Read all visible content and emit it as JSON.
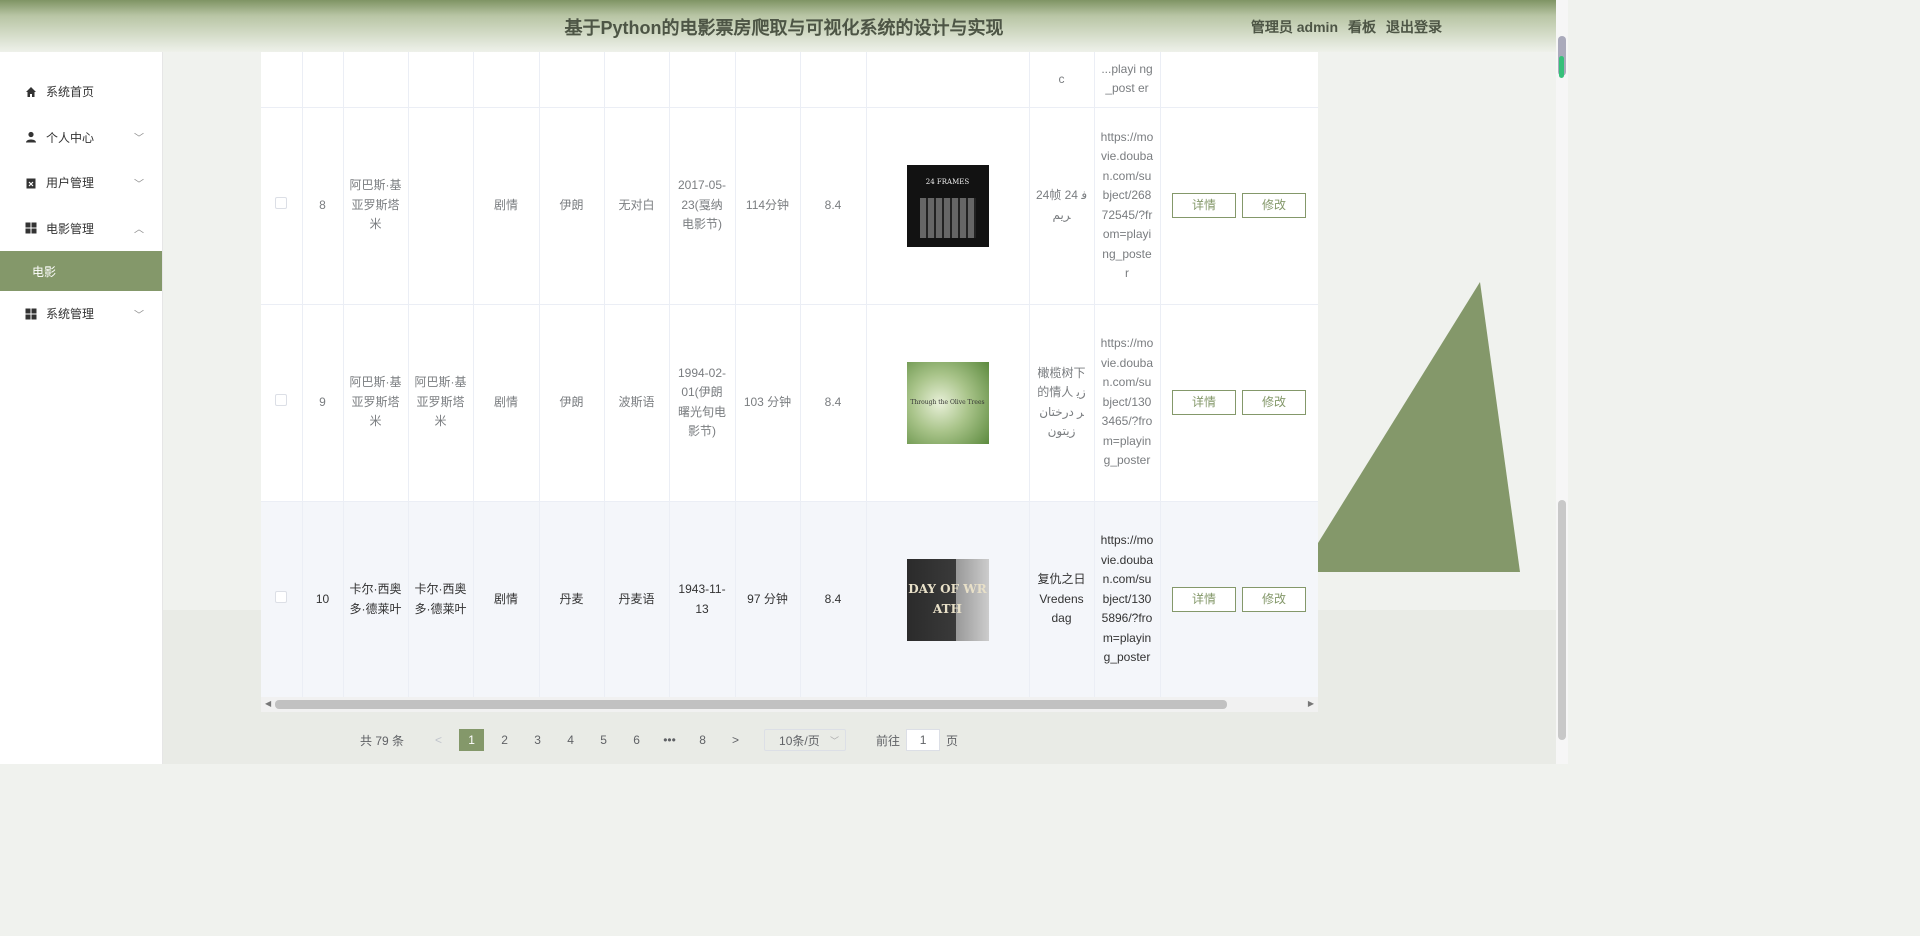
{
  "header": {
    "title": "基于Python的电影票房爬取与可视化系统的设计与实现",
    "admin": "管理员 admin",
    "board": "看板",
    "logout": "退出登录"
  },
  "sidebar": {
    "items": [
      {
        "label": "系统首页"
      },
      {
        "label": "个人中心"
      },
      {
        "label": "用户管理"
      },
      {
        "label": "电影管理"
      },
      {
        "label": "电影"
      },
      {
        "label": "系统管理"
      }
    ]
  },
  "table": {
    "partial_row": {
      "c11": "c",
      "c12": "...playi ng_post er"
    },
    "rows": [
      {
        "id": "8",
        "director": "阿巴斯·基亚罗斯塔米",
        "writer": "",
        "genre": "剧情",
        "country": "伊朗",
        "language": "无对白",
        "date": "2017-05-23(戛纳电影节)",
        "duration": "114分钟",
        "score": "8.4",
        "poster_title": "24 FRAMES",
        "alt_title": "24帧 24 فریم",
        "url": "https://movie.douban.com/subject/26872545/?from=playing_poster",
        "detail": "详情",
        "edit": "修改"
      },
      {
        "id": "9",
        "director": "阿巴斯·基亚罗斯塔米",
        "writer": "阿巴斯·基亚罗斯塔米",
        "genre": "剧情",
        "country": "伊朗",
        "language": "波斯语",
        "date": "1994-02-01(伊朗曙光旬电影节)",
        "duration": "103 分钟",
        "score": "8.4",
        "poster_title": "Through the Olive Trees",
        "alt_title": "橄榄树下的情人 زیر درختان زیتون",
        "url": "https://movie.douban.com/subject/1303465/?from=playing_poster",
        "detail": "详情",
        "edit": "修改"
      },
      {
        "id": "10",
        "director": "卡尔·西奥多·德莱叶",
        "writer": "卡尔·西奥多·德莱叶",
        "genre": "剧情",
        "country": "丹麦",
        "language": "丹麦语",
        "date": "1943-11-13",
        "duration": "97 分钟",
        "score": "8.4",
        "poster_title": "DAY OF WRATH",
        "alt_title": "复仇之日 Vredens dag",
        "url": "https://movie.douban.com/subject/1305896/?from=playing_poster",
        "detail": "详情",
        "edit": "修改"
      }
    ]
  },
  "pagination": {
    "total": "共 79 条",
    "prev": "<",
    "pages": [
      "1",
      "2",
      "3",
      "4",
      "5",
      "6",
      "•••",
      "8"
    ],
    "next": ">",
    "page_size": "10条/页",
    "goto_label": "前往",
    "goto_value": "1",
    "page_unit": "页"
  },
  "colors": {
    "accent": "#84986a"
  }
}
